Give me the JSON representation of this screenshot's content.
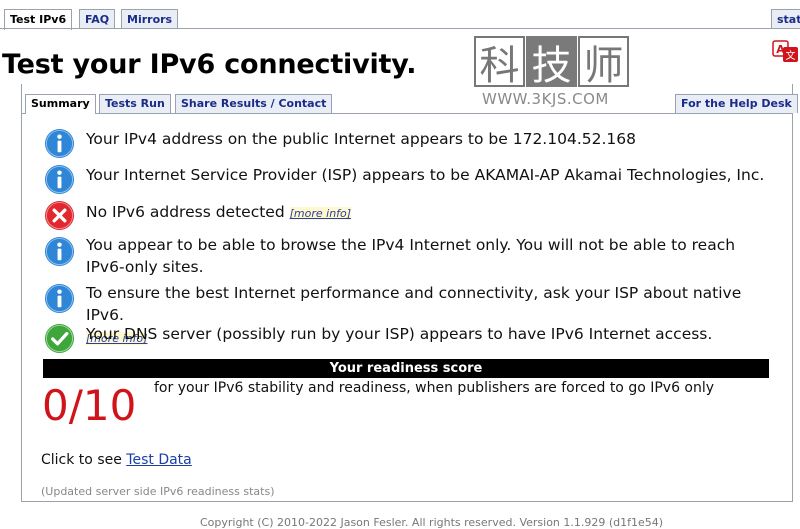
{
  "top_tabs": [
    {
      "label": "Test IPv6"
    },
    {
      "label": "FAQ"
    },
    {
      "label": "Mirrors"
    },
    {
      "label": "stats"
    }
  ],
  "page_title": "Test your IPv6 connectivity.",
  "watermark": {
    "chars": [
      "科",
      "技",
      "师"
    ],
    "url": "WWW.3KJS.COM"
  },
  "sub_tabs": [
    {
      "label": "Summary"
    },
    {
      "label": "Tests Run"
    },
    {
      "label": "Share Results / Contact"
    },
    {
      "label": "For the Help Desk"
    }
  ],
  "results": [
    {
      "icon": "info-icon",
      "text": "Your IPv4 address on the public Internet appears to be 172.104.52.168"
    },
    {
      "icon": "info-icon",
      "text": "Your Internet Service Provider (ISP) appears to be AKAMAI-AP Akamai Technologies, Inc."
    },
    {
      "icon": "error-icon",
      "text": "No IPv6 address detected",
      "link": "[more info]"
    },
    {
      "icon": "info-icon",
      "text": "You appear to be able to browse the IPv4 Internet only. You will not be able to reach IPv6-only sites."
    },
    {
      "icon": "info-icon",
      "text": "To ensure the best Internet performance and connectivity, ask your ISP about native IPv6.",
      "link": "[more info]"
    },
    {
      "icon": "check-icon",
      "text": "Your DNS server (possibly run by your ISP) appears to have IPv6 Internet access."
    }
  ],
  "score": {
    "heading": "Your readiness score",
    "value": "0/10",
    "description": "for your IPv6 stability and readiness, when publishers are forced to go IPv6 only"
  },
  "test_data": {
    "prefix": "Click to see ",
    "link": "Test Data"
  },
  "updated_note": "(Updated server side IPv6 readiness stats)",
  "footer": "Copyright (C) 2010-2022 Jason Fesler. All rights reserved. Version 1.1.929 (d1f1e54)",
  "colors": {
    "info": "#2f86d6",
    "error": "#e0282e",
    "ok": "#3ea63a",
    "score": "#d0141b",
    "link": "#1a3fa8"
  }
}
